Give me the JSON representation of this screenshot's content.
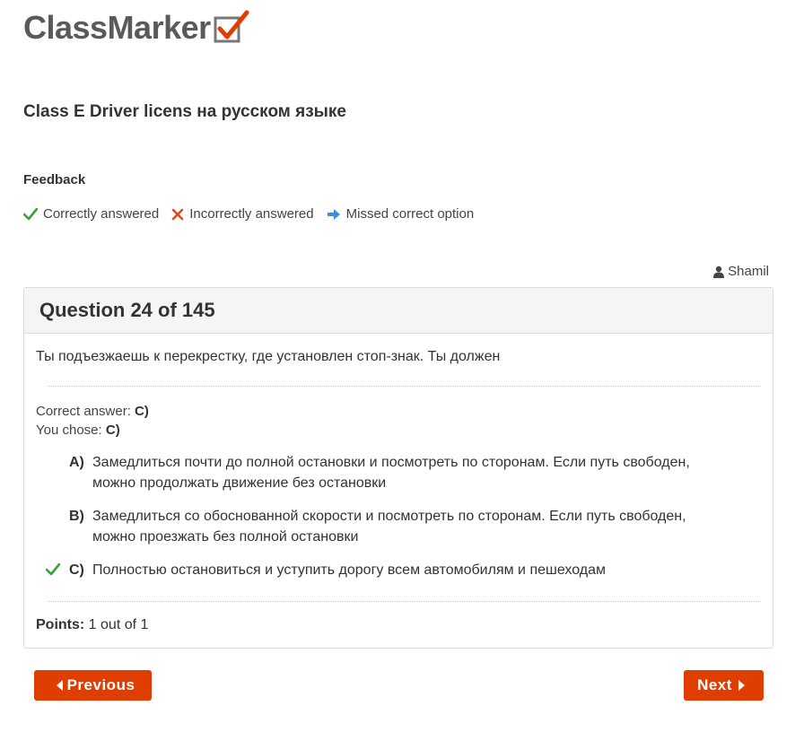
{
  "logo": {
    "text": "ClassMarker",
    "icon": "checkbox-check-icon"
  },
  "exam": {
    "title": "Class E Driver licens на русском языке"
  },
  "feedback": {
    "heading": "Feedback",
    "legend": [
      {
        "icon": "check-icon",
        "label": "Correctly answered",
        "color": "#3c9d3c"
      },
      {
        "icon": "cross-icon",
        "label": "Incorrectly answered",
        "color": "#e04a1b"
      },
      {
        "icon": "arrow-right-icon",
        "label": "Missed correct option",
        "color": "#3a8fe0"
      }
    ]
  },
  "user": {
    "name": "Shamil",
    "icon": "user-icon"
  },
  "question": {
    "title": "Question 24 of 145",
    "text": "Ты подъезжаешь к перекрестку, где установлен стоп-знак. Ты должен",
    "correct_answer_label": "Correct answer:",
    "correct_answer_value": "C)",
    "you_chose_label": "You chose:",
    "you_chose_value": "C)",
    "options": [
      {
        "letter": "A)",
        "text": "Замедлиться почти до полной остановки и посмотреть по сторонам. Если путь свободен, можно продолжать движение без остановки",
        "mark": ""
      },
      {
        "letter": "B)",
        "text": "Замедлиться со обоснованной скорости и посмотреть по сторонам. Если путь свободен, можно проезжать без полной остановки",
        "mark": ""
      },
      {
        "letter": "C)",
        "text": "Полностью остановиться и уступить дорогу всем автомобилям и пешеходам",
        "mark": "check-icon"
      }
    ],
    "points_label": "Points:",
    "points_value": "1 out of 1"
  },
  "nav": {
    "previous": "Previous",
    "next": "Next"
  },
  "colors": {
    "accent": "#e03e00",
    "check": "#3c9d3c",
    "cross": "#e04a1b",
    "arrow": "#3a8fe0"
  }
}
